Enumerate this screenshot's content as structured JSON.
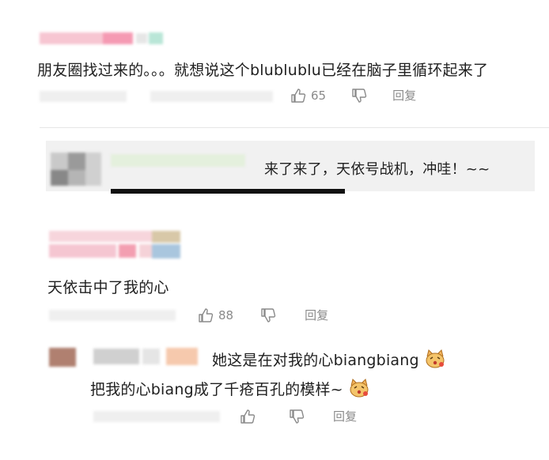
{
  "comments": [
    {
      "text": "朋友圈找过来的。。。就想说这个blublublu已经在脑子里循环起来了",
      "likes": "65",
      "reply_label": "回复"
    },
    {
      "text": "天依击中了我的心",
      "likes": "88",
      "reply_label": "回复"
    }
  ],
  "reply_preview": {
    "text": "来了来了，天依号战机，冲哇！~~"
  },
  "nested_reply": {
    "line1": "她这是在对我的心biangbiang",
    "line2": "把我的心biang成了千疮百孔的模样~",
    "reply_label": "回复"
  },
  "icons": [
    "thumbs-up-icon",
    "thumbs-down-icon",
    "emoji-face-icon"
  ],
  "colors": {
    "text": "#1f1f1f",
    "meta": "#8a8a8a",
    "reply_bg": "#f1f1f1",
    "divider": "#e6e6e6"
  }
}
